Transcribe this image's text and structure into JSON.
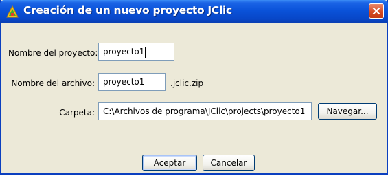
{
  "window": {
    "title": "Creación de un nuevo proyecto JClic"
  },
  "form": {
    "project_name_label": "Nombre del proyecto:",
    "project_name_value": "proyecto1",
    "file_name_label": "Nombre del archivo:",
    "file_name_value": "proyecto1",
    "file_extension": ".jclic.zip",
    "folder_label": "Carpeta:",
    "folder_value": "C:\\Archivos de programa\\JClic\\projects\\proyecto1"
  },
  "buttons": {
    "browse_label": "Navegar...",
    "accept_label": "Aceptar",
    "cancel_label": "Cancelar"
  },
  "icons": {
    "app": "jclic-app-icon",
    "close": "close-icon"
  },
  "colors": {
    "titlebar": "#0a52d9",
    "close_button": "#d64a24",
    "dialog_background": "#ece9d8",
    "field_border": "#7f9db9"
  }
}
